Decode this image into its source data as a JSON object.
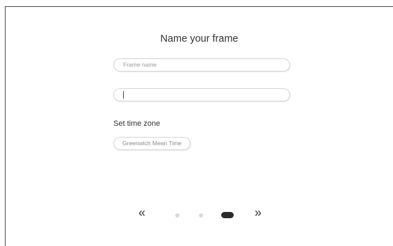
{
  "page": {
    "title": "Name your frame"
  },
  "frame_name": {
    "placeholder": "Frame name",
    "value": ""
  },
  "second_field": {
    "value": ""
  },
  "time_zone": {
    "section_label": "Set time zone",
    "selected": "Greenwich Mean Time"
  },
  "pagination": {
    "prev_icon": "«",
    "next_icon": "»",
    "total_pages": 3,
    "current_page": 3
  },
  "colors": {
    "active_dot": "#2b2b2b",
    "inactive_dot": "#d9d9d9",
    "border": "#d4d4d4",
    "text": "#333333"
  }
}
